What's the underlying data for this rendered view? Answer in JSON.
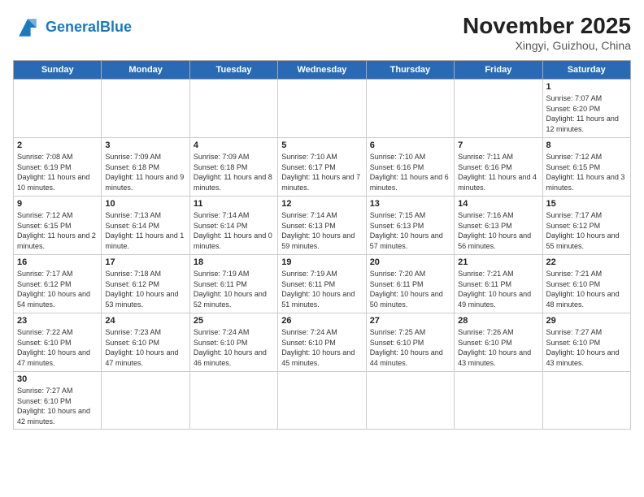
{
  "header": {
    "logo_general": "General",
    "logo_blue": "Blue",
    "month_title": "November 2025",
    "location": "Xingyi, Guizhou, China"
  },
  "days_of_week": [
    "Sunday",
    "Monday",
    "Tuesday",
    "Wednesday",
    "Thursday",
    "Friday",
    "Saturday"
  ],
  "weeks": [
    [
      {
        "day": "",
        "info": ""
      },
      {
        "day": "",
        "info": ""
      },
      {
        "day": "",
        "info": ""
      },
      {
        "day": "",
        "info": ""
      },
      {
        "day": "",
        "info": ""
      },
      {
        "day": "",
        "info": ""
      },
      {
        "day": "1",
        "info": "Sunrise: 7:07 AM\nSunset: 6:20 PM\nDaylight: 11 hours and 12 minutes."
      }
    ],
    [
      {
        "day": "2",
        "info": "Sunrise: 7:08 AM\nSunset: 6:19 PM\nDaylight: 11 hours and 10 minutes."
      },
      {
        "day": "3",
        "info": "Sunrise: 7:09 AM\nSunset: 6:18 PM\nDaylight: 11 hours and 9 minutes."
      },
      {
        "day": "4",
        "info": "Sunrise: 7:09 AM\nSunset: 6:18 PM\nDaylight: 11 hours and 8 minutes."
      },
      {
        "day": "5",
        "info": "Sunrise: 7:10 AM\nSunset: 6:17 PM\nDaylight: 11 hours and 7 minutes."
      },
      {
        "day": "6",
        "info": "Sunrise: 7:10 AM\nSunset: 6:16 PM\nDaylight: 11 hours and 6 minutes."
      },
      {
        "day": "7",
        "info": "Sunrise: 7:11 AM\nSunset: 6:16 PM\nDaylight: 11 hours and 4 minutes."
      },
      {
        "day": "8",
        "info": "Sunrise: 7:12 AM\nSunset: 6:15 PM\nDaylight: 11 hours and 3 minutes."
      }
    ],
    [
      {
        "day": "9",
        "info": "Sunrise: 7:12 AM\nSunset: 6:15 PM\nDaylight: 11 hours and 2 minutes."
      },
      {
        "day": "10",
        "info": "Sunrise: 7:13 AM\nSunset: 6:14 PM\nDaylight: 11 hours and 1 minute."
      },
      {
        "day": "11",
        "info": "Sunrise: 7:14 AM\nSunset: 6:14 PM\nDaylight: 11 hours and 0 minutes."
      },
      {
        "day": "12",
        "info": "Sunrise: 7:14 AM\nSunset: 6:13 PM\nDaylight: 10 hours and 59 minutes."
      },
      {
        "day": "13",
        "info": "Sunrise: 7:15 AM\nSunset: 6:13 PM\nDaylight: 10 hours and 57 minutes."
      },
      {
        "day": "14",
        "info": "Sunrise: 7:16 AM\nSunset: 6:13 PM\nDaylight: 10 hours and 56 minutes."
      },
      {
        "day": "15",
        "info": "Sunrise: 7:17 AM\nSunset: 6:12 PM\nDaylight: 10 hours and 55 minutes."
      }
    ],
    [
      {
        "day": "16",
        "info": "Sunrise: 7:17 AM\nSunset: 6:12 PM\nDaylight: 10 hours and 54 minutes."
      },
      {
        "day": "17",
        "info": "Sunrise: 7:18 AM\nSunset: 6:12 PM\nDaylight: 10 hours and 53 minutes."
      },
      {
        "day": "18",
        "info": "Sunrise: 7:19 AM\nSunset: 6:11 PM\nDaylight: 10 hours and 52 minutes."
      },
      {
        "day": "19",
        "info": "Sunrise: 7:19 AM\nSunset: 6:11 PM\nDaylight: 10 hours and 51 minutes."
      },
      {
        "day": "20",
        "info": "Sunrise: 7:20 AM\nSunset: 6:11 PM\nDaylight: 10 hours and 50 minutes."
      },
      {
        "day": "21",
        "info": "Sunrise: 7:21 AM\nSunset: 6:11 PM\nDaylight: 10 hours and 49 minutes."
      },
      {
        "day": "22",
        "info": "Sunrise: 7:21 AM\nSunset: 6:10 PM\nDaylight: 10 hours and 48 minutes."
      }
    ],
    [
      {
        "day": "23",
        "info": "Sunrise: 7:22 AM\nSunset: 6:10 PM\nDaylight: 10 hours and 47 minutes."
      },
      {
        "day": "24",
        "info": "Sunrise: 7:23 AM\nSunset: 6:10 PM\nDaylight: 10 hours and 47 minutes."
      },
      {
        "day": "25",
        "info": "Sunrise: 7:24 AM\nSunset: 6:10 PM\nDaylight: 10 hours and 46 minutes."
      },
      {
        "day": "26",
        "info": "Sunrise: 7:24 AM\nSunset: 6:10 PM\nDaylight: 10 hours and 45 minutes."
      },
      {
        "day": "27",
        "info": "Sunrise: 7:25 AM\nSunset: 6:10 PM\nDaylight: 10 hours and 44 minutes."
      },
      {
        "day": "28",
        "info": "Sunrise: 7:26 AM\nSunset: 6:10 PM\nDaylight: 10 hours and 43 minutes."
      },
      {
        "day": "29",
        "info": "Sunrise: 7:27 AM\nSunset: 6:10 PM\nDaylight: 10 hours and 43 minutes."
      }
    ],
    [
      {
        "day": "30",
        "info": "Sunrise: 7:27 AM\nSunset: 6:10 PM\nDaylight: 10 hours and 42 minutes."
      },
      {
        "day": "",
        "info": ""
      },
      {
        "day": "",
        "info": ""
      },
      {
        "day": "",
        "info": ""
      },
      {
        "day": "",
        "info": ""
      },
      {
        "day": "",
        "info": ""
      },
      {
        "day": "",
        "info": ""
      }
    ]
  ]
}
